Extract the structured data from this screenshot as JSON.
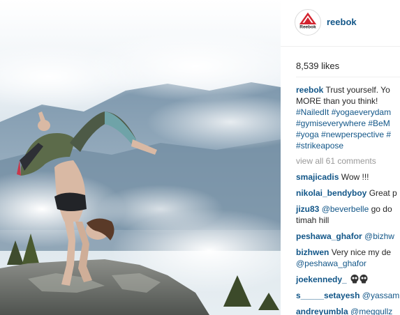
{
  "post": {
    "username": "reebok",
    "avatar_brand": "Reebok",
    "likes": "8,539 likes",
    "caption": {
      "user": "reebok",
      "line1": "Trust yourself. Yo",
      "line2": "MORE than you think!",
      "line3": "#NailedIt #yogaeverydam",
      "line4": "#gymiseverywhere #BeM",
      "line5": "#yoga #newperspective #",
      "line6": "#strikeapose"
    },
    "view_all": "view all 61 comments",
    "comments": [
      {
        "user": "smajicadis",
        "text": "Wow !!!"
      },
      {
        "user": "nikolai_bendyboy",
        "text": "Great p"
      },
      {
        "user": "jizu83",
        "mention": "@beverbelle",
        "text": "go do",
        "text2": "timah hill"
      },
      {
        "user": "peshawa_ghafor",
        "mention": "@bizhw"
      },
      {
        "user": "bizhwen",
        "text": "Very nice my de",
        "mention2": "@peshawa_ghafor"
      },
      {
        "user": "joekennedy_",
        "emoji": "skull-skull"
      },
      {
        "user": "s_____setayesh",
        "mention": "@yassam"
      },
      {
        "user": "andreyumbla",
        "mention": "@meggullz"
      }
    ]
  },
  "colors": {
    "link": "#125688",
    "muted": "#999999",
    "brand_red": "#d3242f"
  }
}
